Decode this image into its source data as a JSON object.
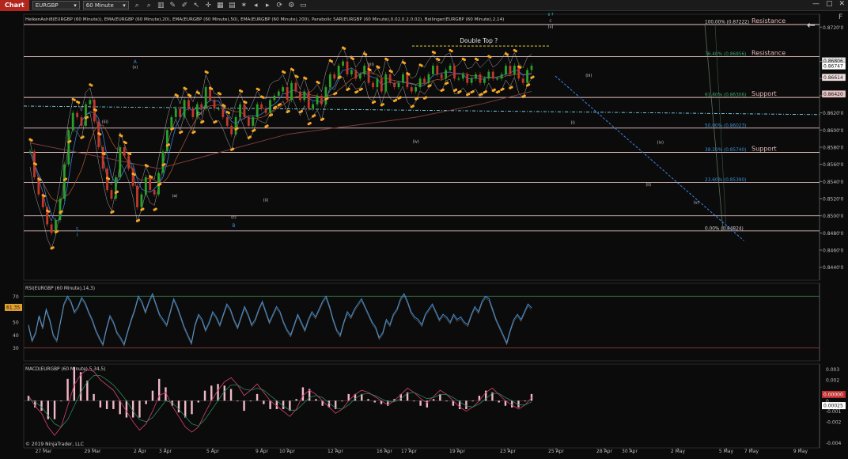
{
  "toolbar": {
    "tab_label": "Chart",
    "instrument": "EURGBP",
    "timeframe": "60 Minute",
    "icons": [
      "magnifier-icon",
      "magnifier-icon",
      "chart-style-icon",
      "brush-icon",
      "pencil-icon",
      "arrow-icon",
      "crosshair-icon",
      "text-icon",
      "grid-icon",
      "star-icon",
      "nav-left-icon",
      "nav-right-icon",
      "refresh-icon",
      "gear-icon",
      "window-icon"
    ]
  },
  "window": {
    "fit_label": "F",
    "close_label": "✕"
  },
  "colors": {
    "background": "#0b0b0b",
    "resistance_line": "#e8c2c2",
    "sar": "#f5a623",
    "bollinger": "#d8d8d8",
    "ema20": "#3a7bd5",
    "ema50": "#a0522d",
    "ema200": "#7a3b3b",
    "up_candle": "#2aa02a",
    "down_candle": "#c0392b",
    "fib_green": "#3aa36a",
    "fib_blue": "#3a8fd8",
    "rsi": "#3c8dde",
    "macd": "#c23b6b",
    "histogram": "#f0b8c8"
  },
  "chart_data": [
    {
      "type": "line",
      "title": "HeikenAshi8(EURGBP (60 Minute)), EMA(EURGBP (60 Minute),20), EMA(EURGBP (60 Minute),50), EMA(EURGBP (60 Minute),200), Parabolic SAR(EURGBP (60 Minute),0.02,0.2,0.02), Bollinger(EURGBP (60 Minute),2,14)",
      "x_tick_labels": [
        "27 Mar",
        "29 Mar",
        "2 Apr",
        "3 Apr",
        "5 Apr",
        "9 Apr",
        "10 Apr",
        "12 Apr",
        "16 Apr",
        "17 Apr",
        "19 Apr",
        "23 Apr",
        "25 Apr",
        "28 Apr",
        "30 Apr",
        "2 May",
        "5 May",
        "7 May",
        "9 May"
      ],
      "y_ticks": [
        0.844,
        0.846,
        0.848,
        0.85,
        0.852,
        0.854,
        0.856,
        0.858,
        0.86,
        0.862,
        0.864,
        0.866,
        0.868,
        0.872
      ],
      "y_tick_labels": [
        "0.8440'0",
        "0.8460'0",
        "0.8480'0",
        "0.8500'0",
        "0.8520'0",
        "0.8540'0",
        "0.8560'0",
        "0.8580'0",
        "0.8600'0",
        "0.8620'0",
        "0.8640'0",
        "0.8660'0",
        "0.8680'0",
        "0.8720'0"
      ],
      "ylim": [
        0.8425,
        0.8735
      ],
      "price_badges": [
        {
          "label": "0.86806",
          "value": 0.86806,
          "color": "#e6e6e6"
        },
        {
          "label": "0.86747",
          "value": 0.86747,
          "color": "#ffffff"
        },
        {
          "label": "0.86614",
          "value": 0.86614,
          "color": "#f0e0e0"
        },
        {
          "label": "0.86420",
          "value": 0.8642,
          "color": "#e8c2c2"
        }
      ],
      "series": [
        {
          "name": "HeikenAshi close",
          "x_index": [
            0,
            4,
            8,
            12,
            16,
            20,
            24,
            28,
            32,
            36,
            40,
            44,
            48,
            52,
            56,
            60,
            64,
            68,
            72,
            76,
            80,
            84,
            88,
            92,
            96,
            100,
            104,
            108,
            112,
            116,
            120,
            124,
            128,
            132,
            136,
            140,
            144,
            148,
            152,
            156,
            160,
            164,
            168,
            172,
            176,
            180,
            184,
            188,
            192,
            196,
            200,
            204,
            208,
            212,
            216,
            220,
            224,
            228,
            232,
            236,
            240,
            244,
            248,
            252,
            256,
            260,
            264,
            268,
            272,
            276,
            280,
            284,
            288,
            292,
            296,
            300,
            304,
            308,
            312,
            316,
            320,
            324,
            328,
            332,
            336,
            340,
            344,
            348,
            352,
            356,
            360,
            364,
            368,
            372,
            376,
            380,
            384,
            388,
            392,
            396,
            400,
            404,
            408,
            412,
            416,
            420,
            424,
            428,
            432,
            436,
            440,
            444,
            448,
            452,
            456,
            460,
            464,
            468
          ],
          "values": [
            0.8575,
            0.8545,
            0.8525,
            0.851,
            0.849,
            0.848,
            0.8495,
            0.852,
            0.856,
            0.86,
            0.862,
            0.8615,
            0.8605,
            0.863,
            0.8635,
            0.861,
            0.858,
            0.8555,
            0.853,
            0.852,
            0.8545,
            0.858,
            0.857,
            0.8555,
            0.8535,
            0.851,
            0.8525,
            0.8545,
            0.853,
            0.8525,
            0.855,
            0.8575,
            0.86,
            0.8615,
            0.8625,
            0.8615,
            0.8635,
            0.8625,
            0.8615,
            0.863,
            0.8625,
            0.865,
            0.8635,
            0.8625,
            0.8625,
            0.8615,
            0.8605,
            0.8595,
            0.8615,
            0.863,
            0.8615,
            0.8605,
            0.8615,
            0.863,
            0.8625,
            0.862,
            0.8635,
            0.864,
            0.8645,
            0.865,
            0.8635,
            0.8655,
            0.8645,
            0.8635,
            0.8645,
            0.8625,
            0.863,
            0.864,
            0.863,
            0.865,
            0.8665,
            0.866,
            0.8675,
            0.868,
            0.8665,
            0.867,
            0.866,
            0.8665,
            0.8675,
            0.8655,
            0.865,
            0.866,
            0.8645,
            0.8665,
            0.8655,
            0.865,
            0.8655,
            0.8665,
            0.865,
            0.8645,
            0.865,
            0.866,
            0.8655,
            0.8665,
            0.8675,
            0.8665,
            0.866,
            0.867,
            0.8675,
            0.866,
            0.866,
            0.8665,
            0.8655,
            0.866,
            0.8665,
            0.8655,
            0.866,
            0.8668,
            0.866,
            0.866,
            0.8665,
            0.8675,
            0.8665,
            0.8675,
            0.866,
            0.8655,
            0.867,
            0.8675
          ]
        },
        {
          "name": "EMA200",
          "x_index": [
            0,
            60,
            120,
            180,
            240,
            300,
            360,
            420,
            468
          ],
          "values": [
            0.8585,
            0.857,
            0.8555,
            0.8575,
            0.8595,
            0.8605,
            0.8615,
            0.863,
            0.8645
          ]
        }
      ],
      "horizontal_lines": [
        {
          "value": 0.8723,
          "label": "100.00% (0.87222)",
          "side_label": "Resistance"
        },
        {
          "value": 0.86856,
          "label": "76.40% (0.86856)",
          "side_label": "Resistance"
        },
        {
          "value": 0.8638,
          "label": "61.80% (0.86306)",
          "side_label": "Support"
        },
        {
          "value": 0.86023,
          "label": "50.00% (0.86023)",
          "side_label": ""
        },
        {
          "value": 0.8574,
          "label": "38.20% (0.85740)",
          "side_label": "Support"
        },
        {
          "value": 0.8539,
          "label": "23.60% (0.85390)",
          "side_label": ""
        },
        {
          "value": 0.85,
          "label": "",
          "side_label": ""
        },
        {
          "value": 0.84824,
          "label": "0.00% (0.84824)",
          "side_label": ""
        }
      ],
      "cyan_dashed_line": {
        "from_value": 0.8628,
        "to_value": 0.8618
      },
      "double_top": {
        "value": 0.8698,
        "label": "Double Top ?"
      },
      "projection_line": {
        "from_value": 0.8663,
        "to_value": 0.8471
      },
      "wave_labels": [
        {
          "text": "A",
          "x_index": 98,
          "value": 0.8678,
          "color": "#3a8fd8"
        },
        {
          "text": "B",
          "x_index": 190,
          "value": 0.8487,
          "color": "#3a8fd8"
        },
        {
          "text": "5",
          "x_index": 44,
          "value": 0.8482,
          "color": "#3a8fd8"
        },
        {
          "text": "i",
          "x_index": 44,
          "value": 0.8476,
          "color": "#2bd0c0"
        },
        {
          "text": "ii ?",
          "x_index": 662,
          "value": 0.8733,
          "color": "#2bd0c0"
        },
        {
          "text": "c",
          "x_index": 662,
          "value": 0.8726,
          "color": "#a09ad8"
        },
        {
          "text": "(v)",
          "x_index": 662,
          "value": 0.8719,
          "color": "#cccccc"
        },
        {
          "text": "(iii)",
          "x_index": 318,
          "value": 0.8675,
          "color": "#cccccc"
        },
        {
          "text": "(iv)",
          "x_index": 360,
          "value": 0.8585,
          "color": "#cccccc"
        },
        {
          "text": "(v)",
          "x_index": 98,
          "value": 0.8672,
          "color": "#cccccc"
        },
        {
          "text": "(iii)",
          "x_index": 70,
          "value": 0.8608,
          "color": "#cccccc"
        },
        {
          "text": "(a)",
          "x_index": 135,
          "value": 0.8522,
          "color": "#cccccc"
        },
        {
          "text": "(b)",
          "x_index": 158,
          "value": 0.8618,
          "color": "#cccccc"
        },
        {
          "text": "(c)",
          "x_index": 190,
          "value": 0.8497,
          "color": "#cccccc"
        },
        {
          "text": "(ii)",
          "x_index": 220,
          "value": 0.8517,
          "color": "#cccccc"
        },
        {
          "text": "(iii)",
          "x_index": 710,
          "value": 0.8662,
          "color": "#cccccc"
        },
        {
          "text": "(iv)",
          "x_index": 800,
          "value": 0.8584,
          "color": "#cccccc"
        },
        {
          "text": "(i)",
          "x_index": 690,
          "value": 0.8607,
          "color": "#cccccc"
        },
        {
          "text": "(ii)",
          "x_index": 785,
          "value": 0.8535,
          "color": "#cccccc"
        },
        {
          "text": "(v)",
          "x_index": 845,
          "value": 0.8514,
          "color": "#cccccc"
        }
      ]
    },
    {
      "type": "line",
      "title": "RSI(EURGBP (60 Minute),14,3)",
      "ylim": [
        20,
        80
      ],
      "y_ticks": [
        30,
        40,
        50,
        60,
        70
      ],
      "y_tick_labels": [
        "30",
        "40",
        "50",
        "60",
        "70"
      ],
      "current_badge": "61.35",
      "overbought": 70,
      "oversold": 30,
      "series": [
        {
          "name": "RSI",
          "values": [
            48,
            36,
            42,
            55,
            46,
            60,
            52,
            40,
            36,
            50,
            64,
            70,
            66,
            58,
            62,
            69,
            65,
            58,
            52,
            44,
            38,
            33,
            45,
            55,
            50,
            42,
            38,
            33,
            43,
            52,
            60,
            70,
            66,
            58,
            66,
            72,
            64,
            56,
            52,
            48,
            58,
            68,
            62,
            54,
            46,
            40,
            34,
            48,
            56,
            52,
            44,
            50,
            58,
            54,
            48,
            56,
            64,
            60,
            52,
            46,
            54,
            62,
            56,
            48,
            52,
            60,
            66,
            58,
            50,
            56,
            62,
            58,
            50,
            44,
            40,
            48,
            56,
            50,
            44,
            52,
            58,
            54,
            60,
            66,
            70,
            62,
            52,
            44,
            40,
            50,
            58,
            54,
            60,
            64,
            68,
            62,
            56,
            50,
            46,
            38,
            42,
            52,
            48,
            56,
            60,
            68,
            72,
            66,
            58,
            54,
            52,
            48,
            56,
            60,
            64,
            58,
            52,
            56,
            54,
            50,
            56,
            52,
            54,
            50,
            48,
            56,
            62,
            58,
            66,
            70,
            68,
            60,
            52,
            46,
            40,
            34,
            44,
            52,
            56,
            52,
            58,
            64,
            61
          ]
        }
      ]
    },
    {
      "type": "bar",
      "title": "MACD(EURGBP (60 Minute),5,34,5)",
      "ylim": [
        -0.0045,
        0.0035
      ],
      "y_ticks": [
        -0.004,
        -0.002,
        -0.001,
        0,
        0.002,
        0.003
      ],
      "y_tick_labels": [
        "-0.004",
        "-0.002",
        "-0.001",
        "0",
        "0.002",
        "0.003"
      ],
      "current_badges": [
        "0.00000",
        "0.00025"
      ],
      "copyright": "© 2019 NinjaTrader, LLC",
      "series": [
        {
          "name": "MACD",
          "values": [
            0.0005,
            -0.0005,
            -0.0012,
            -0.0025,
            -0.0033,
            -0.0025,
            -0.0005,
            0.0015,
            0.0025,
            0.003,
            0.0028,
            0.002,
            0.0015,
            0.001,
            0.0,
            -0.001,
            -0.002,
            -0.0028,
            -0.0022,
            -0.001,
            0.0005,
            0.0008,
            -0.0005,
            -0.0015,
            -0.0025,
            -0.003,
            -0.0025,
            -0.0012,
            0.0,
            0.001,
            0.0018,
            0.0022,
            0.0015,
            0.0005,
            0.001,
            0.0016,
            0.0008,
            0.0,
            -0.0005,
            -0.001,
            -0.0015,
            -0.0008,
            0.0005,
            0.001,
            0.0006,
            0.0,
            -0.0006,
            -0.0012,
            -0.0008,
            0.0,
            0.0006,
            0.001,
            0.0008,
            0.0004,
            0.0,
            -0.0004,
            0.0,
            0.0006,
            0.0012,
            0.0008,
            0.0002,
            -0.0002,
            0.0004,
            0.001,
            0.0006,
            0.0,
            -0.0006,
            -0.001,
            -0.0006,
            0.0,
            0.0008,
            0.0012,
            0.0006,
            0.0,
            -0.0004,
            -0.0008,
            -0.0004,
            0.0003
          ]
        },
        {
          "name": "Signal",
          "values": [
            0.0002,
            -0.0001,
            -0.0006,
            -0.0014,
            -0.0022,
            -0.0025,
            -0.0018,
            -0.0005,
            0.0008,
            0.0018,
            0.0024,
            0.0024,
            0.002,
            0.0015,
            0.0008,
            0.0,
            -0.001,
            -0.0018,
            -0.002,
            -0.0016,
            -0.0008,
            0.0,
            -0.0002,
            -0.0008,
            -0.0015,
            -0.0022,
            -0.0024,
            -0.0018,
            -0.0009,
            0.0,
            0.0009,
            0.0015,
            0.0015,
            0.0011,
            0.001,
            0.0012,
            0.001,
            0.0005,
            0.0,
            -0.0005,
            -0.0009,
            -0.0009,
            -0.0003,
            0.0003,
            0.0005,
            0.0003,
            -0.0002,
            -0.0007,
            -0.0008,
            -0.0004,
            0.0002,
            0.0006,
            0.0007,
            0.0005,
            0.0002,
            -0.0001,
            -0.0001,
            0.0002,
            0.0007,
            0.0008,
            0.0005,
            0.0002,
            0.0003,
            0.0006,
            0.0006,
            0.0003,
            -0.0001,
            -0.0005,
            -0.0006,
            -0.0003,
            0.0002,
            0.0007,
            0.0007,
            0.0003,
            0.0,
            -0.0004,
            -0.0004,
            -0.0001
          ]
        }
      ]
    }
  ]
}
